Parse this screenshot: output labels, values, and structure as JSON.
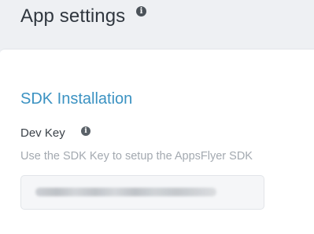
{
  "header": {
    "title": "App settings",
    "info_glyph": "i"
  },
  "sdk_section": {
    "title": "SDK Installation",
    "dev_key": {
      "label": "Dev Key",
      "info_glyph": "i",
      "help_text": "Use the SDK Key to setup the AppsFlyer SDK",
      "value_state": "blurred"
    }
  },
  "colors": {
    "page_background": "#eef0f3",
    "card_background": "#ffffff",
    "section_title": "#3b92c2",
    "help_text": "#a3a9b0",
    "input_background": "#f5f6f8"
  },
  "icons": [
    "info-icon"
  ]
}
